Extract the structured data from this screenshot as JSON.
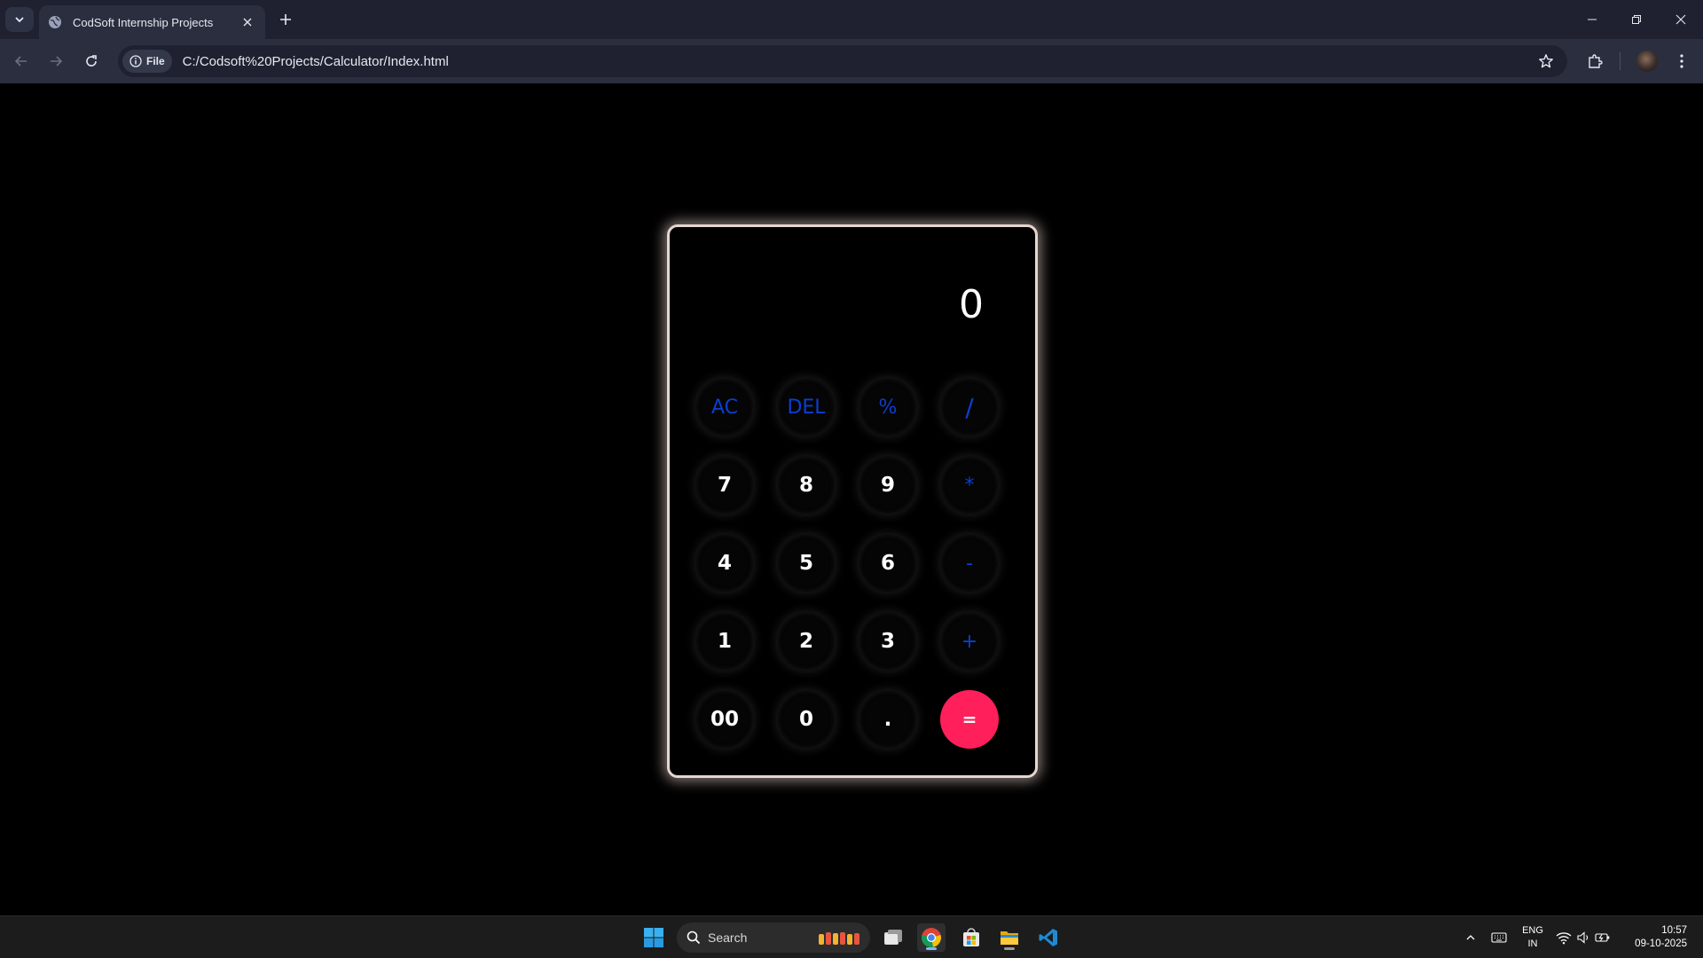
{
  "browser": {
    "tab_title": "CodSoft Internship Projects",
    "chip_label": "File",
    "url": "C:/Codsoft%20Projects/Calculator/Index.html"
  },
  "calculator": {
    "display_value": "0",
    "keys": {
      "ac": "AC",
      "del": "DEL",
      "percent": "%",
      "divide": "/",
      "seven": "7",
      "eight": "8",
      "nine": "9",
      "multiply": "*",
      "four": "4",
      "five": "5",
      "six": "6",
      "minus": "-",
      "one": "1",
      "two": "2",
      "three": "3",
      "plus": "+",
      "double_zero": "00",
      "zero": "0",
      "dot": ".",
      "equals": "="
    },
    "colors": {
      "operator": "#0a3fd0",
      "equals": "#ff1f5a",
      "border_glow": "#e5d6d0"
    }
  },
  "taskbar": {
    "search_label": "Search",
    "language_line1": "ENG",
    "language_line2": "IN",
    "time": "10:57",
    "date": "09-10-2025"
  }
}
